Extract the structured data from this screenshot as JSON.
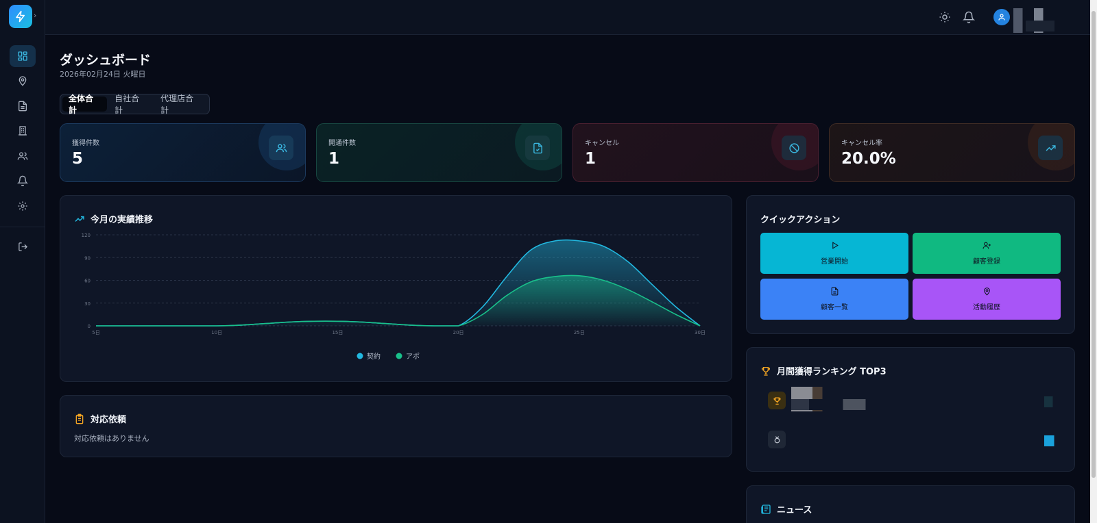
{
  "colors": {
    "bg": "#070b17",
    "panel": "#0f1627",
    "accent_cyan": "#06b6d4",
    "accent_green": "#10b981",
    "accent_blue": "#3b82f6",
    "accent_purple": "#a855f7",
    "trophy": "#f5a623"
  },
  "sidebar": {
    "logo_icon": "lightning-icon",
    "items": [
      {
        "icon": "dashboard-icon",
        "active": true
      },
      {
        "icon": "map-pin-icon",
        "active": false
      },
      {
        "icon": "document-icon",
        "active": false
      },
      {
        "icon": "building-icon",
        "active": false
      },
      {
        "icon": "users-icon",
        "active": false
      },
      {
        "icon": "bell-icon",
        "active": false
      },
      {
        "icon": "gear-icon",
        "active": false
      }
    ],
    "logout_icon": "logout-icon"
  },
  "header": {
    "theme_icon": "sun-icon",
    "notification_icon": "bell-icon",
    "avatar_icon": "user-icon"
  },
  "page": {
    "title": "ダッシュボード",
    "date": "2026年02月24日 火曜日"
  },
  "tabs": [
    {
      "label": "全体合計",
      "active": true
    },
    {
      "label": "自社合計",
      "active": false
    },
    {
      "label": "代理店合計",
      "active": false
    }
  ],
  "stats": [
    {
      "label": "獲得件数",
      "value": "5",
      "icon": "users-icon",
      "color": "#3ab7e0"
    },
    {
      "label": "開通件数",
      "value": "1",
      "icon": "file-check-icon",
      "color": "#3ab7e0"
    },
    {
      "label": "キャンセル",
      "value": "1",
      "icon": "ban-icon",
      "color": "#3ab7e0"
    },
    {
      "label": "キャンセル率",
      "value": "20.0%",
      "icon": "trending-up-icon",
      "color": "#3ab7e0"
    }
  ],
  "chart_card": {
    "title": "今月の実績推移",
    "icon": "trending-up-icon"
  },
  "chart_data": {
    "type": "area",
    "x": [
      "5日",
      "6日",
      "7日",
      "8日",
      "9日",
      "10日",
      "11日",
      "12日",
      "13日",
      "14日",
      "15日",
      "16日",
      "17日",
      "18日",
      "19日",
      "20日",
      "21日",
      "22日",
      "23日",
      "24日",
      "25日",
      "26日",
      "27日",
      "28日",
      "29日",
      "30日"
    ],
    "x_ticks": [
      "5日",
      "10日",
      "15日",
      "20日",
      "25日",
      "30日"
    ],
    "series": [
      {
        "name": "契約",
        "color": "#22b8e0",
        "values": [
          0,
          0,
          0,
          0,
          0,
          0,
          1,
          3,
          5,
          6,
          6,
          5,
          3,
          1,
          0,
          0,
          25,
          65,
          100,
          112,
          112,
          105,
          85,
          55,
          25,
          0
        ]
      },
      {
        "name": "アポ",
        "color": "#19c08a",
        "values": [
          0,
          0,
          0,
          0,
          0,
          0,
          1,
          3,
          5,
          6,
          6,
          5,
          3,
          1,
          0,
          0,
          15,
          40,
          58,
          65,
          66,
          60,
          48,
          32,
          15,
          0
        ]
      }
    ],
    "ylim": [
      0,
      120
    ],
    "y_ticks": [
      "0",
      "30",
      "60",
      "90",
      "120"
    ],
    "grid": true,
    "legend": "bottom-center"
  },
  "request_card": {
    "title": "対応依頼",
    "icon": "clipboard-icon",
    "empty_text": "対応依頼はありません"
  },
  "quick_actions": {
    "title": "クイックアクション",
    "buttons": [
      {
        "label": "営業開始",
        "icon": "play-icon",
        "color": "#06b6d4"
      },
      {
        "label": "顧客登録",
        "icon": "user-plus-icon",
        "color": "#10b981"
      },
      {
        "label": "顧客一覧",
        "icon": "document-icon",
        "color": "#3b82f6"
      },
      {
        "label": "活動履歴",
        "icon": "map-pin-icon",
        "color": "#a855f7"
      }
    ]
  },
  "ranking": {
    "title": "月間獲得ランキング TOP3",
    "icon": "trophy-icon",
    "rows": [
      {
        "badge_icon": "trophy-icon"
      },
      {
        "badge_icon": "medal-icon"
      }
    ]
  },
  "news": {
    "title": "ニュース",
    "icon": "newspaper-icon"
  }
}
